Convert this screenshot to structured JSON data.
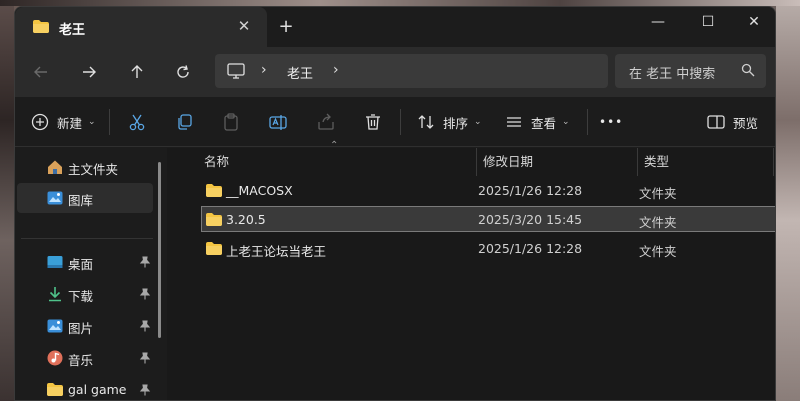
{
  "window": {
    "tab_title": "老王",
    "new_tab_label": "+",
    "close_tab_label": "✕",
    "minimize_label": "—",
    "maximize_label": "☐",
    "close_label": "✕"
  },
  "address": {
    "crumbs": [
      "老王"
    ],
    "search_placeholder": "在 老王 中搜索"
  },
  "toolbar": {
    "new_label": "新建",
    "sort_label": "排序",
    "view_label": "查看",
    "more_label": "•••",
    "preview_label": "预览"
  },
  "sidebar": {
    "items": [
      {
        "label": "主文件夹",
        "icon": "home-icon"
      },
      {
        "label": "图库",
        "icon": "gallery-icon",
        "selected": true
      },
      {
        "label": "桌面",
        "icon": "desktop-icon",
        "pinned": true
      },
      {
        "label": "下载",
        "icon": "download-icon",
        "pinned": true
      },
      {
        "label": "图片",
        "icon": "pictures-icon",
        "pinned": true
      },
      {
        "label": "音乐",
        "icon": "music-icon",
        "pinned": true
      },
      {
        "label": "gal game",
        "icon": "folder-icon",
        "pinned": true
      }
    ]
  },
  "columns": {
    "name": "名称",
    "date": "修改日期",
    "type": "类型"
  },
  "files": [
    {
      "name": "__MACOSX",
      "date": "2025/1/26 12:28",
      "type": "文件夹",
      "selected": false
    },
    {
      "name": "3.20.5",
      "date": "2025/3/20 15:45",
      "type": "文件夹",
      "selected": true
    },
    {
      "name": "上老王论坛当老王",
      "date": "2025/1/26 12:28",
      "type": "文件夹",
      "selected": false
    }
  ],
  "colors": {
    "folder": "#f4c542",
    "background": "#1c1c1c",
    "selection": "#3a3a3a"
  }
}
